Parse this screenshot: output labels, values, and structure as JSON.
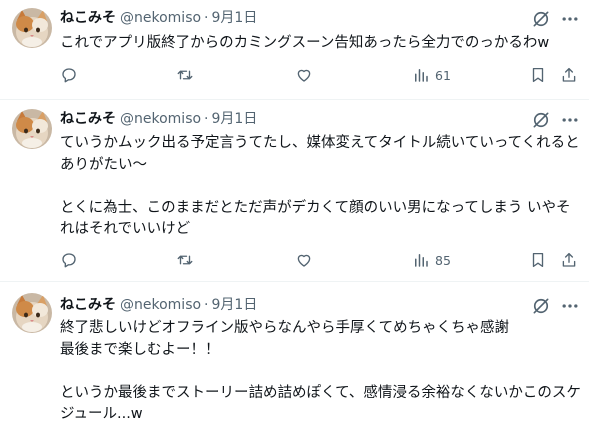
{
  "colors": {
    "text": "#0f1419",
    "muted": "#536471",
    "divider": "#eff3f4",
    "background": "#ffffff"
  },
  "icons": [
    "grok-icon",
    "more-icon",
    "reply-icon",
    "retweet-icon",
    "like-icon",
    "views-icon",
    "bookmark-icon",
    "share-icon",
    "cat-avatar"
  ],
  "tweets": [
    {
      "name": "ねこみそ",
      "handle": "@nekomiso",
      "dot": "·",
      "date": "9月1日",
      "text": "これでアプリ版終了からのカミングスーン告知あったら全力でのっかるわw",
      "views": "61"
    },
    {
      "name": "ねこみそ",
      "handle": "@nekomiso",
      "dot": "·",
      "date": "9月1日",
      "text": "ていうかムック出る予定言うてたし、媒体変えてタイトル続いていってくれるとありがたい〜\n\nとくに為士、このままだとただ声がデカくて顔のいい男になってしまう いやそれはそれでいいけど",
      "views": "85"
    },
    {
      "name": "ねこみそ",
      "handle": "@nekomiso",
      "dot": "·",
      "date": "9月1日",
      "text": "終了悲しいけどオフライン版やらなんやら手厚くてめちゃくちゃ感謝\n最後まで楽しむよー！！\n\nというか最後までストーリー詰め詰めぽくて、感情浸る余裕なくないかこのスケジュール...w",
      "views": ""
    }
  ]
}
